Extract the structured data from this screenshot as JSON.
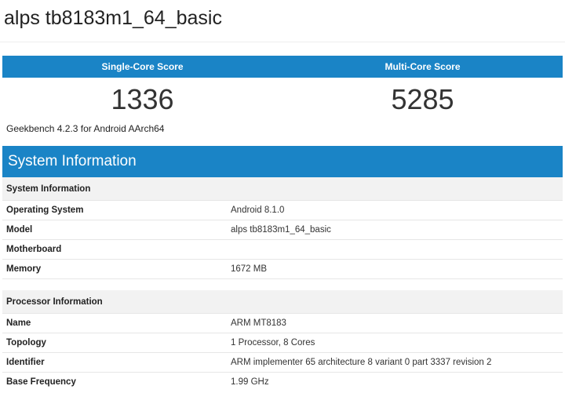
{
  "title": "alps tb8183m1_64_basic",
  "scores": {
    "single_label": "Single-Core Score",
    "multi_label": "Multi-Core Score",
    "single_value": "1336",
    "multi_value": "5285"
  },
  "version": "Geekbench 4.2.3 for Android AArch64",
  "section_title": "System Information",
  "system": {
    "group_label": "System Information",
    "rows": [
      {
        "key": "Operating System",
        "value": "Android 8.1.0"
      },
      {
        "key": "Model",
        "value": "alps tb8183m1_64_basic"
      },
      {
        "key": "Motherboard",
        "value": ""
      },
      {
        "key": "Memory",
        "value": "1672 MB"
      }
    ]
  },
  "processor": {
    "group_label": "Processor Information",
    "rows": [
      {
        "key": "Name",
        "value": "ARM MT8183"
      },
      {
        "key": "Topology",
        "value": "1 Processor, 8 Cores"
      },
      {
        "key": "Identifier",
        "value": "ARM implementer 65 architecture 8 variant 0 part 3337 revision 2"
      },
      {
        "key": "Base Frequency",
        "value": "1.99 GHz"
      }
    ]
  },
  "colors": {
    "accent": "#1a84c6",
    "group_bg": "#f2f2f2"
  }
}
